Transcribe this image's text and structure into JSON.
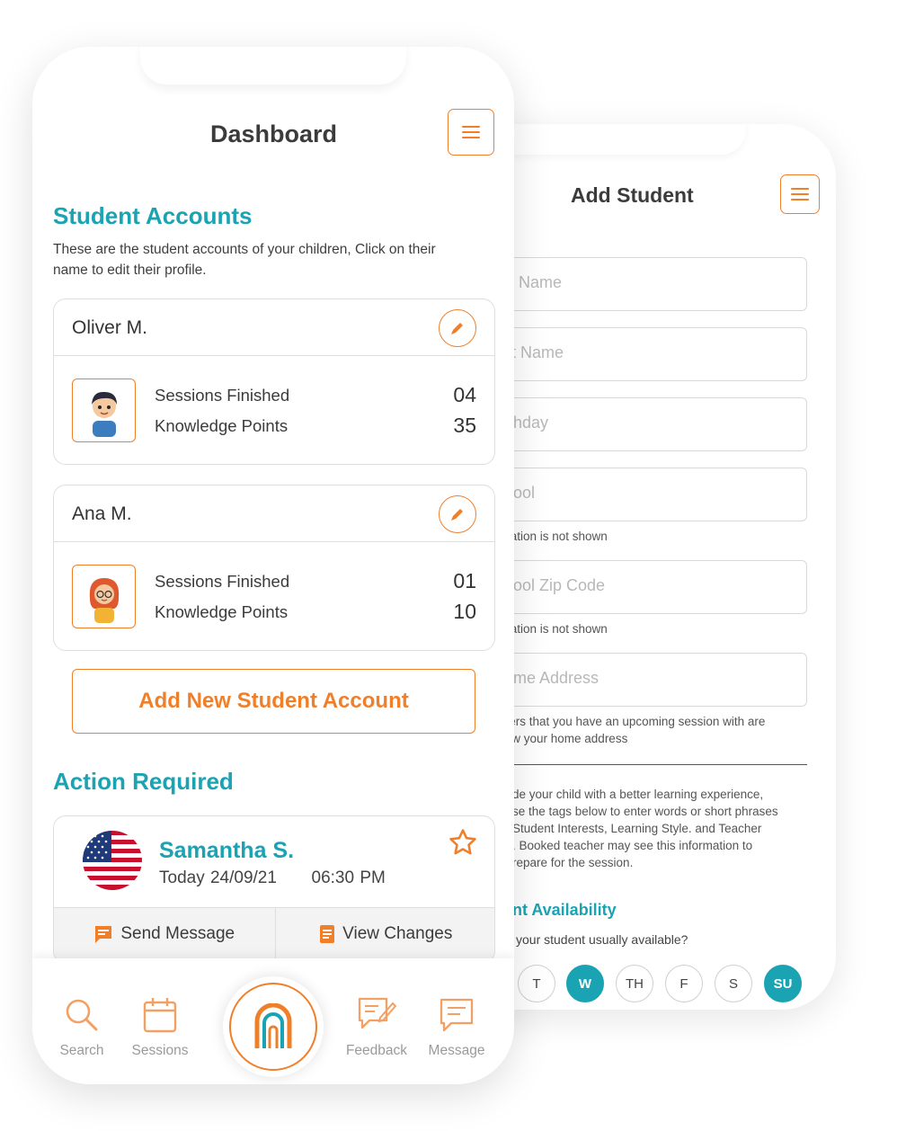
{
  "add_student": {
    "title": "Add Student",
    "fields": [
      {
        "placeholder": "Name"
      },
      {
        "placeholder": "t Name"
      },
      {
        "placeholder": "hday"
      },
      {
        "placeholder": "ool"
      },
      {
        "placeholder": "ool Zip Code"
      },
      {
        "placeholder": "me Address"
      }
    ],
    "hints": {
      "school_info": "rmation is not shown",
      "zip_info": "rmation is not shown",
      "address_line1": "chers that you have an upcoming session with are",
      "address_line2": "view your home address",
      "tags_line1": "de your child with a better learning experience,",
      "tags_line2": "se the tags below to enter words or short phrases",
      "tags_line3": "Student Interests, Learning Style. and Teacher",
      "tags_line4": ". Booked teacher may see this information to",
      "tags_line5": "repare for the session."
    },
    "availability": {
      "title": "nt Availability",
      "subtitle": "your student usually available?",
      "days": [
        {
          "label": "T",
          "active": false
        },
        {
          "label": "W",
          "active": true
        },
        {
          "label": "TH",
          "active": false
        },
        {
          "label": "F",
          "active": false
        },
        {
          "label": "S",
          "active": false
        },
        {
          "label": "SU",
          "active": true
        }
      ]
    }
  },
  "dashboard": {
    "title": "Dashboard",
    "student_accounts": {
      "heading": "Student Accounts",
      "description": "These are the student accounts of your children, Click on their name to edit their profile.",
      "students": [
        {
          "name": "Oliver M.",
          "sessions_label": "Sessions Finished",
          "sessions": "04",
          "points_label": "Knowledge Points",
          "points": "35",
          "avatar": "boy-avatar"
        },
        {
          "name": "Ana M.",
          "sessions_label": "Sessions Finished",
          "sessions": "01",
          "points_label": "Knowledge Points",
          "points": "10",
          "avatar": "girl-avatar"
        }
      ],
      "add_button": "Add New Student Account"
    },
    "action_required": {
      "heading": "Action Required",
      "tutor_name": "Samantha S.",
      "date": "Today 24/09/21",
      "time": "06:30 PM",
      "flag": "us-flag-icon",
      "send_message": "Send Message",
      "view_changes": "View Changes"
    },
    "tabbar": [
      {
        "label": "Search",
        "icon": "search-icon"
      },
      {
        "label": "Sessions",
        "icon": "calendar-icon"
      },
      {
        "label": "Feedback",
        "icon": "feedback-icon"
      },
      {
        "label": "Message",
        "icon": "message-icon"
      }
    ]
  },
  "colors": {
    "accent_orange": "#f07f2a",
    "accent_teal": "#1aa3b3"
  }
}
